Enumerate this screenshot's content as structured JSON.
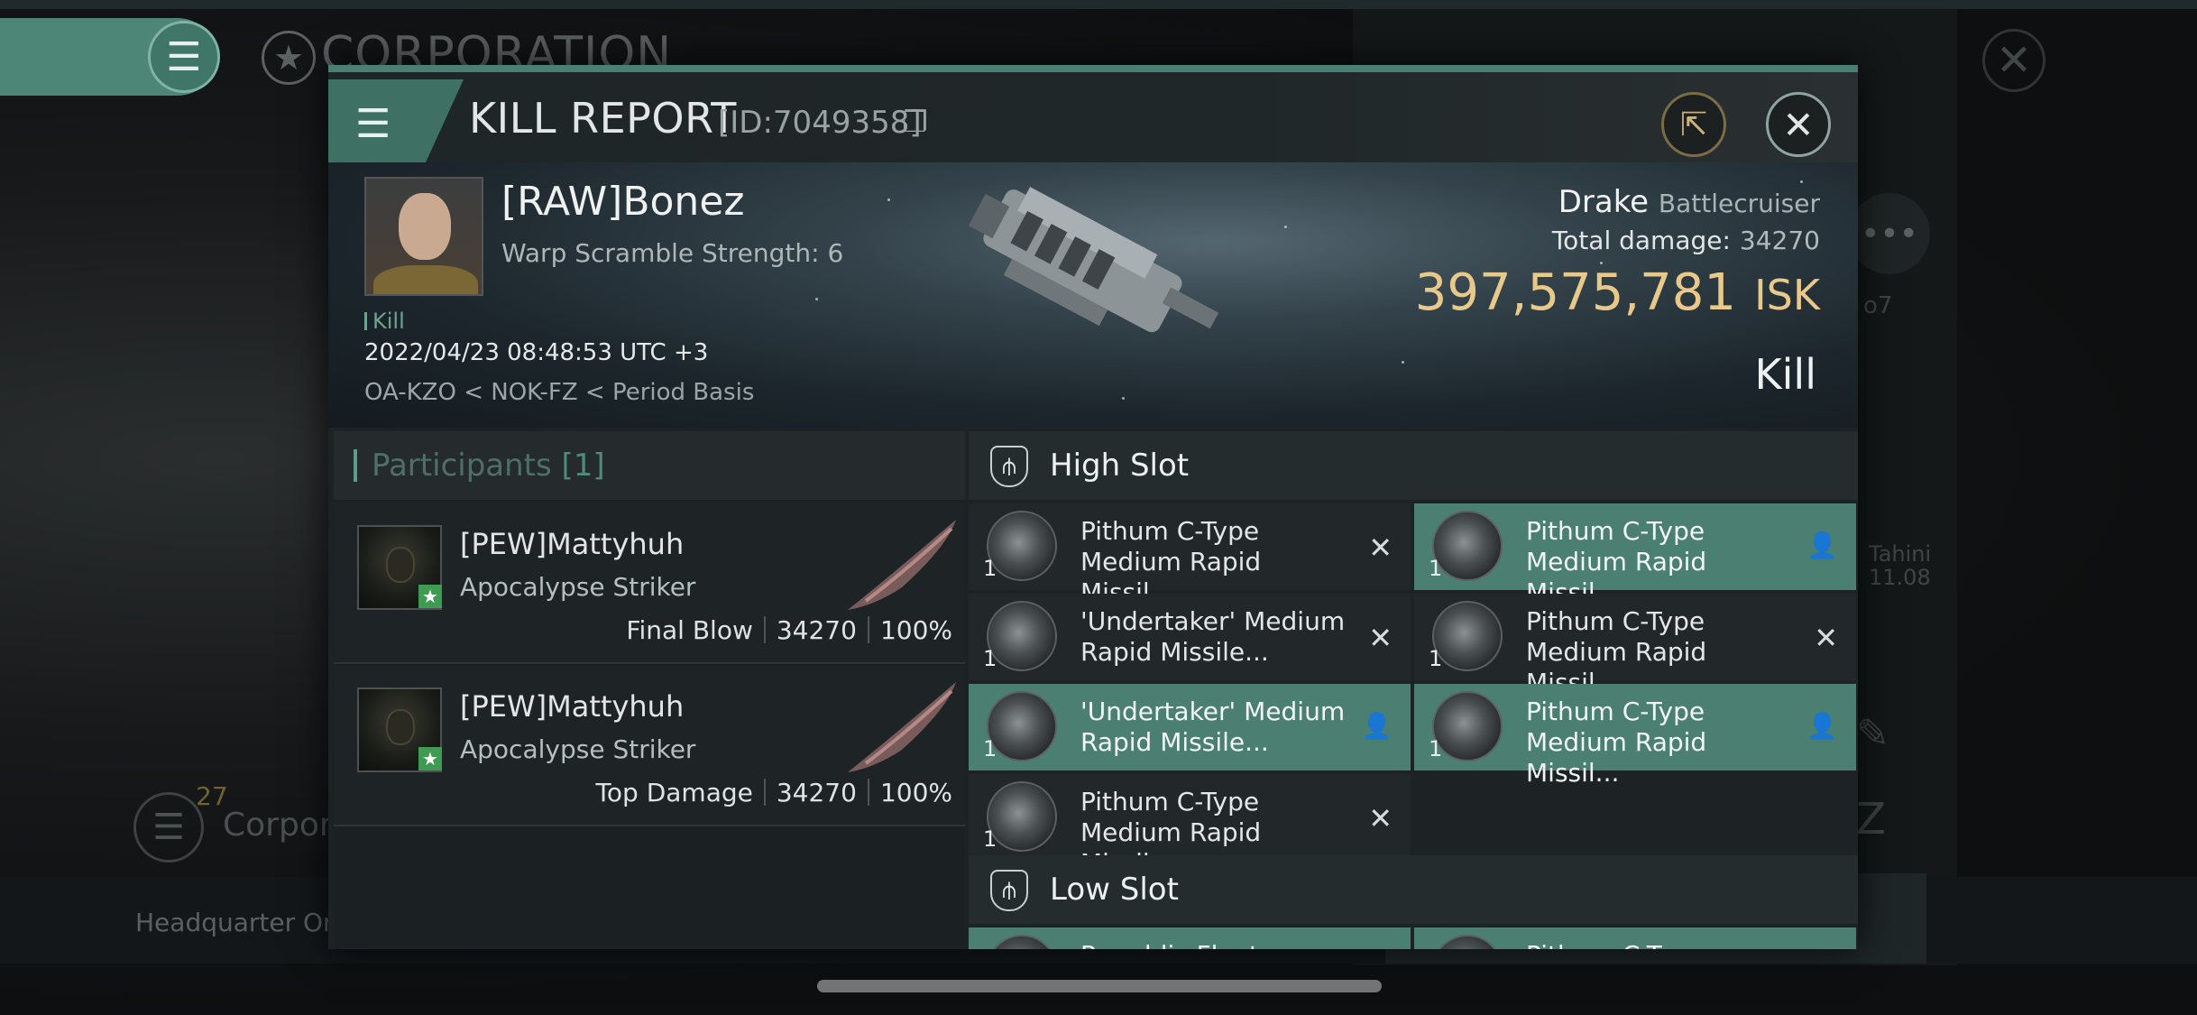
{
  "background": {
    "section_title": "CORPORATION",
    "corp_count": "27",
    "corp_label": "Corpora",
    "hq_label": "Headquarter Orvo",
    "side_text_1": "o7",
    "side_text_2": "Tahini",
    "side_text_3": "11.08"
  },
  "modal": {
    "title": "KILL REPORT",
    "id_label": "[ID:7049358]"
  },
  "victim": {
    "name": "[RAW]Bonez",
    "warp_scramble": "Warp Scramble Strength: 6",
    "tag": "Kill",
    "datetime": "2022/04/23 08:48:53 UTC +3",
    "location": "OA-KZO < NOK-FZ < Period Basis",
    "ship_name": "Drake",
    "ship_class": "Battlecruiser",
    "total_damage_label": "Total damage:",
    "total_damage": "34270",
    "isk_value": "397,575,781",
    "isk_unit": "ISK",
    "result": "Kill"
  },
  "participants": {
    "title": "Participants",
    "count": "[1]",
    "rows": [
      {
        "name": "[PEW]Mattyhuh",
        "ship": "Apocalypse Striker",
        "role": "Final Blow",
        "damage": "34270",
        "percent": "100%"
      },
      {
        "name": "[PEW]Mattyhuh",
        "ship": "Apocalypse Striker",
        "role": "Top Damage",
        "damage": "34270",
        "percent": "100%"
      }
    ]
  },
  "slots": {
    "high_title": "High Slot",
    "low_title": "Low Slot",
    "high_modules": [
      {
        "qty": "1",
        "name": "Pithum C-Type Medium Rapid Missil...",
        "state": "destroyed"
      },
      {
        "qty": "1",
        "name": "Pithum C-Type Medium Rapid Missil...",
        "state": "dropped"
      },
      {
        "qty": "1",
        "name": "'Undertaker' Medium Rapid Missile...",
        "state": "destroyed"
      },
      {
        "qty": "1",
        "name": "Pithum C-Type Medium Rapid Missil...",
        "state": "destroyed"
      },
      {
        "qty": "1",
        "name": "'Undertaker' Medium Rapid Missile...",
        "state": "dropped"
      },
      {
        "qty": "1",
        "name": "Pithum C-Type Medium Rapid Missil...",
        "state": "dropped"
      },
      {
        "qty": "1",
        "name": "Pithum C-Type Medium Rapid Missil...",
        "state": "destroyed"
      }
    ],
    "low_modules": [
      {
        "name": "Republic Fleet ...",
        "state": "dropped"
      },
      {
        "name": "Pithum C-Type ...",
        "state": "dropped"
      }
    ]
  },
  "icons": {
    "menu": "hamburger-icon",
    "copy": "copy-icon",
    "share": "share-icon",
    "close": "close-icon",
    "destroyed": "x-icon",
    "dropped": "person-icon"
  },
  "colors": {
    "accent": "#4a7f71",
    "isk": "#e9c98a",
    "badge": "#3f9a52"
  }
}
